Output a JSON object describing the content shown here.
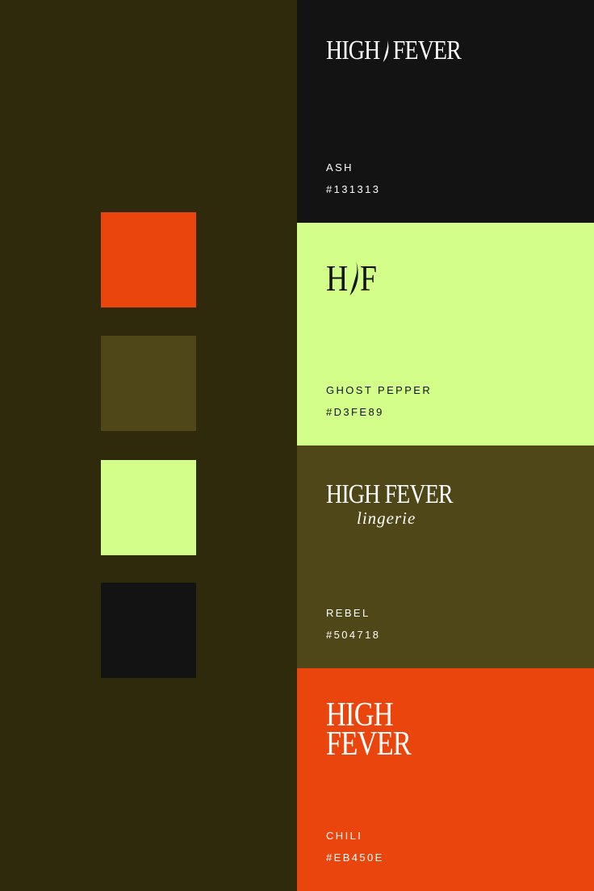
{
  "palette": {
    "swatches": [
      {
        "color": "#EB450E"
      },
      {
        "color": "#504718"
      },
      {
        "color": "#D3FE89"
      },
      {
        "color": "#131313"
      }
    ],
    "cards": [
      {
        "name": "ASH",
        "hex": "#131313",
        "background": "#131313",
        "text_color": "#ffffff",
        "logo": {
          "type": "wordmark",
          "left": "HIGH",
          "right": "FEVER",
          "icon": "chili-flame-icon"
        }
      },
      {
        "name": "GHOST PEPPER",
        "hex": "#D3FE89",
        "background": "#D3FE89",
        "text_color": "#131313",
        "logo": {
          "type": "monogram",
          "left": "H",
          "right": "F",
          "icon": "chili-flame-icon"
        }
      },
      {
        "name": "REBEL",
        "hex": "#504718",
        "background": "#504718",
        "text_color": "#ffffff",
        "logo": {
          "type": "lingerie",
          "main": "HIGH FEVER",
          "sub": "lingerie"
        }
      },
      {
        "name": "CHILI",
        "hex": "#EB450E",
        "background": "#EB450E",
        "text_color": "#ffffff",
        "logo": {
          "type": "stacked",
          "line1": "HIGH",
          "line2": "FEVER"
        }
      }
    ]
  }
}
